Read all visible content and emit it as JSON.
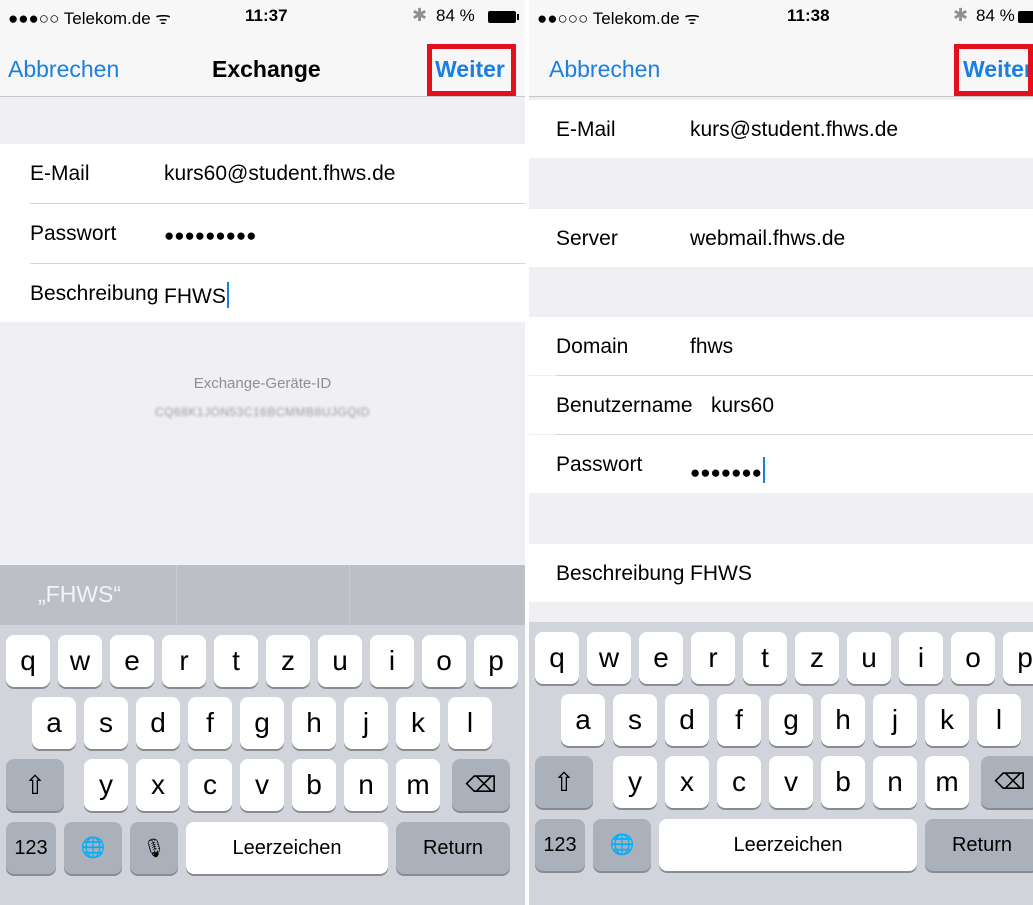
{
  "left": {
    "status": {
      "carrier": "●●●○○ Telekom.de ᯤ",
      "time": "11:37",
      "bluetooth": "✱",
      "battery": "84 %"
    },
    "nav": {
      "cancel": "Abbrechen",
      "title": "Exchange",
      "next": "Weiter"
    },
    "form": [
      {
        "label": "E-Mail",
        "value": "kurs60@student.fhws.de"
      },
      {
        "label": "Passwort",
        "value": "●●●●●●●●●"
      },
      {
        "label": "Beschreibung",
        "value": "FHWS"
      }
    ],
    "device_id_label": "Exchange-Geräte-ID",
    "device_id_value": "CQ68K1JON53C16BCMMB8UJGQID",
    "suggestion": "„FHWS“",
    "keyboard": {
      "row1": [
        "q",
        "w",
        "e",
        "r",
        "t",
        "z",
        "u",
        "i",
        "o",
        "p"
      ],
      "row2": [
        "a",
        "s",
        "d",
        "f",
        "g",
        "h",
        "j",
        "k",
        "l"
      ],
      "row3": [
        "y",
        "x",
        "c",
        "v",
        "b",
        "n",
        "m"
      ],
      "numbers": "123",
      "space": "Leerzeichen",
      "return": "Return"
    }
  },
  "right": {
    "status": {
      "carrier": "●●○○○ Telekom.de ᯤ",
      "time": "11:38",
      "bluetooth": "✱",
      "battery": "84 %"
    },
    "nav": {
      "cancel": "Abbrechen",
      "next": "Weiter"
    },
    "email": {
      "label": "E-Mail",
      "value": "kurs@student.fhws.de"
    },
    "server": {
      "label": "Server",
      "value": "webmail.fhws.de"
    },
    "domain": {
      "label": "Domain",
      "value": "fhws"
    },
    "username": {
      "label": "Benutzername",
      "value": "kurs60"
    },
    "password": {
      "label": "Passwort",
      "value": "●●●●●●●"
    },
    "description": {
      "label": "Beschreibung",
      "value": "FHWS"
    },
    "keyboard": {
      "row1": [
        "q",
        "w",
        "e",
        "r",
        "t",
        "z",
        "u",
        "i",
        "o",
        "p"
      ],
      "row2": [
        "a",
        "s",
        "d",
        "f",
        "g",
        "h",
        "j",
        "k",
        "l"
      ],
      "row3": [
        "y",
        "x",
        "c",
        "v",
        "b",
        "n",
        "m"
      ],
      "numbers": "123",
      "space": "Leerzeichen",
      "return": "Return"
    }
  },
  "icons": {
    "shift": "⇧",
    "delete": "⌫",
    "globe": "🌐",
    "mic": "🎙"
  },
  "colors": {
    "accent": "#1a7fe0",
    "highlight": "#e3101c",
    "keyboard_bg": "#d1d5db"
  }
}
